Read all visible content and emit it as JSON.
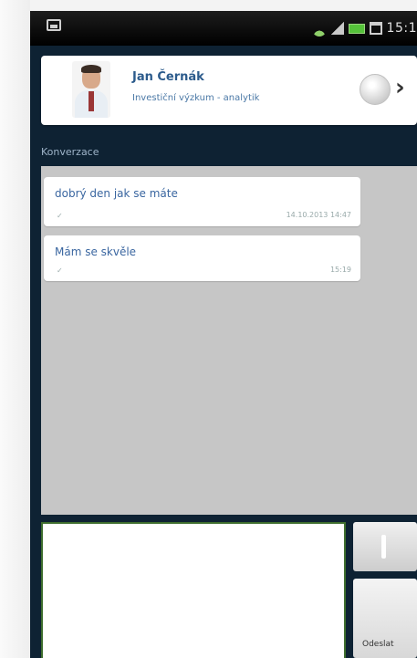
{
  "status_bar": {
    "time": "15:1",
    "icons": [
      "image-icon",
      "wifi-icon",
      "signal-icon",
      "battery-icon",
      "calendar-icon"
    ]
  },
  "contact": {
    "name": "Jan Černák",
    "role": "Investiční výzkum - analytik"
  },
  "conversation": {
    "header": "Konverzace",
    "messages": [
      {
        "text": "dobrý den jak se máte",
        "time": "14.10.2013 14:47"
      },
      {
        "text": "Mám se skvěle",
        "time": "15:19"
      }
    ]
  },
  "compose": {
    "placeholder": "",
    "send_label": "Odeslat"
  },
  "colors": {
    "screen_bg": "#0e2233",
    "accent_text": "#2c5b8c",
    "messages_bg": "#c6c6c6"
  }
}
